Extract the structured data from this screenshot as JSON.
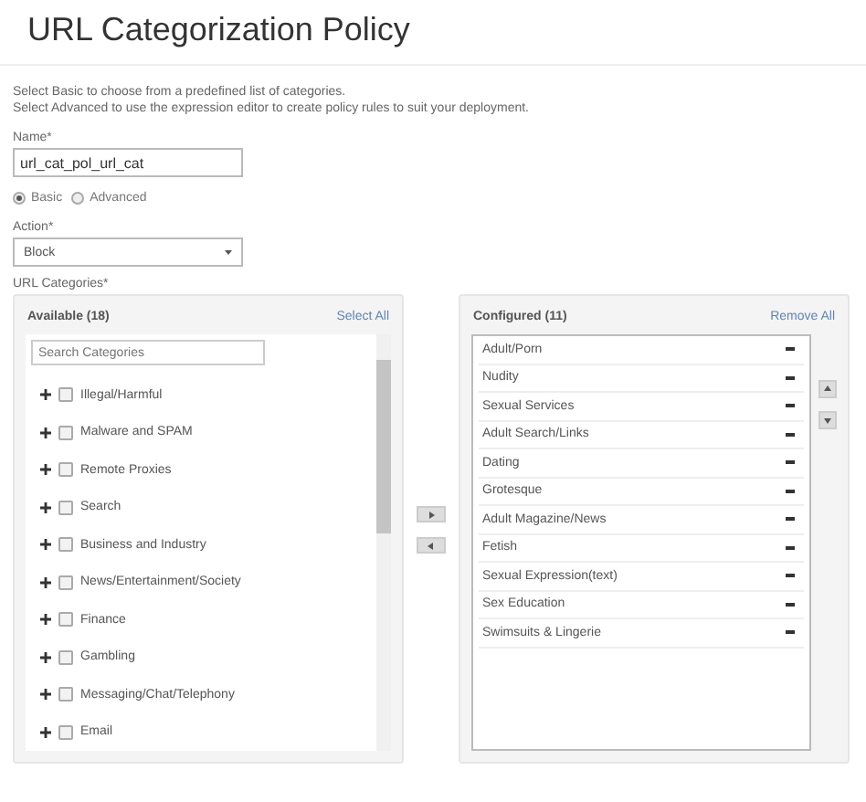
{
  "title": "URL Categorization Policy",
  "description": [
    "Select Basic to choose from a predefined list of categories.",
    "Select Advanced to use the expression editor to create policy rules to suit your deployment."
  ],
  "name_field": {
    "label": "Name*",
    "value": "url_cat_pol_url_cat"
  },
  "mode": [
    {
      "label": "Basic",
      "selected": true
    },
    {
      "label": "Advanced",
      "selected": false
    }
  ],
  "action": {
    "label": "Action*",
    "value": "Block"
  },
  "url_categories": {
    "label": "URL Categories*",
    "available": {
      "title": "Available (18)",
      "select_all": "Select All",
      "search": {
        "placeholder": "Search Categories"
      },
      "items": [
        {
          "label": "Illegal/Harmful",
          "checked": false
        },
        {
          "label": "Malware and SPAM",
          "checked": false
        },
        {
          "label": "Remote Proxies",
          "checked": false
        },
        {
          "label": "Search",
          "checked": false
        },
        {
          "label": "Business and Industry",
          "checked": false
        },
        {
          "label": "News/Entertainment/Society",
          "checked": false
        },
        {
          "label": "Finance",
          "checked": false
        },
        {
          "label": "Gambling",
          "checked": false
        },
        {
          "label": "Messaging/Chat/Telephony",
          "checked": false
        },
        {
          "label": "Email",
          "checked": false
        }
      ]
    },
    "configured": {
      "title": "Configured (11)",
      "remove_all": "Remove All",
      "items": [
        "Adult/Porn",
        "Nudity",
        "Sexual Services",
        "Adult Search/Links",
        "Dating",
        "Grotesque",
        "Adult Magazine/News",
        "Fetish",
        "Sexual Expression(text)",
        "Sex Education",
        "Swimsuits & Lingerie"
      ]
    }
  }
}
